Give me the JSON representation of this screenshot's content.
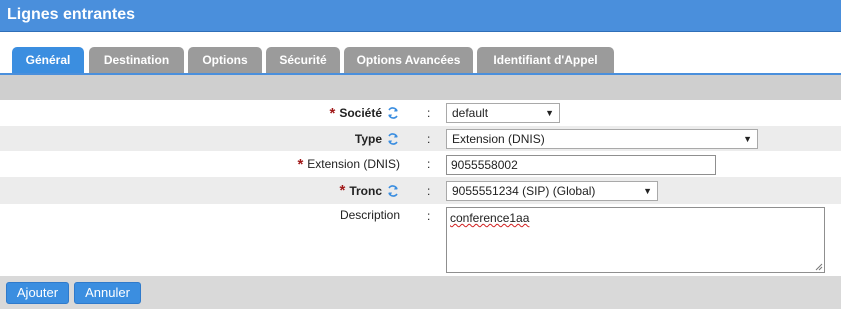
{
  "header": {
    "title": "Lignes entrantes"
  },
  "tabs": [
    {
      "label": "Général",
      "active": true
    },
    {
      "label": "Destination"
    },
    {
      "label": "Options"
    },
    {
      "label": "Sécurité"
    },
    {
      "label": "Options Avancées"
    },
    {
      "label": "Identifiant d'Appel"
    }
  ],
  "form": {
    "societe": {
      "label": "Société",
      "required": true,
      "value": "default"
    },
    "type": {
      "label": "Type",
      "required": false,
      "value": "Extension (DNIS)"
    },
    "extension": {
      "label": "Extension (DNIS)",
      "required": true,
      "value": "9055558002"
    },
    "tronc": {
      "label": "Tronc",
      "required": true,
      "value": "9055551234 (SIP) (Global)"
    },
    "description": {
      "label": "Description",
      "value": "conference1aa"
    },
    "colon": ":",
    "required_mark": "*"
  },
  "buttons": {
    "add": "Ajouter",
    "cancel": "Annuler"
  },
  "colors": {
    "accent": "#4a8fdc",
    "tab_active": "#3b8ee0",
    "tab_inactive": "#9b9b9b",
    "required": "#a01818"
  }
}
